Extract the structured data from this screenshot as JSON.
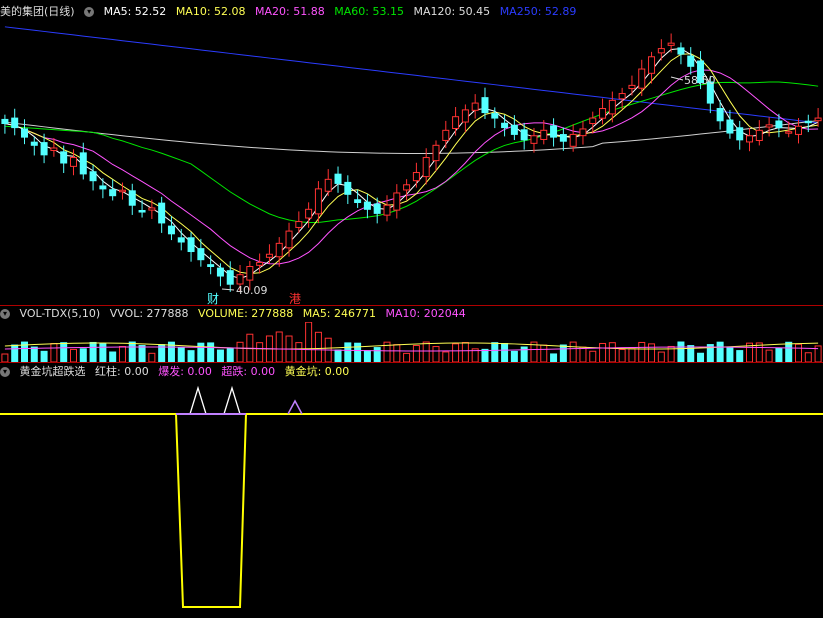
{
  "main_header": {
    "title": "美的集团(日线)",
    "ma5": "MA5: 52.52",
    "ma10": "MA10: 52.08",
    "ma20": "MA20: 51.88",
    "ma60": "MA60: 53.15",
    "ma120": "MA120: 50.45",
    "ma250": "MA250: 52.89"
  },
  "price_labels": {
    "high": "58.50",
    "low": "40.09",
    "tag1": "财",
    "tag2": "港"
  },
  "vol_header": {
    "title": "VOL-TDX(5,10)",
    "vvol": "VVOL: 277888",
    "volume": "VOLUME: 277888",
    "ma5": "MA5: 246771",
    "ma10": "MA10: 202044"
  },
  "ind_header": {
    "title": "黄金坑超跌选",
    "red": "红柱: 0.00",
    "burst": "爆发: 0.00",
    "over": "超跌: 0.00",
    "gold": "黄金坑: 0.00"
  },
  "colors": {
    "up": "#ff3232",
    "down": "#54ffff",
    "ma5": "#ffffff",
    "ma10": "#ffff54",
    "ma20": "#ff54ff",
    "ma60": "#00e600",
    "ma120": "#d0d0d0",
    "ma250": "#2b3cff",
    "indicator": "#ffff00",
    "burst": "#c080ff"
  },
  "chart_data": {
    "type": "candlestick",
    "y_range": [
      40.09,
      58.5
    ],
    "series_close": [
      52.4,
      52.1,
      51.4,
      50.8,
      50.1,
      50.6,
      49.5,
      49.9,
      48.7,
      48.2,
      47.6,
      47.1,
      47.5,
      46.4,
      45.9,
      46.2,
      45.1,
      44.3,
      43.7,
      43.0,
      42.4,
      41.9,
      41.2,
      40.6,
      41.3,
      41.9,
      42.2,
      42.8,
      43.6,
      44.5,
      45.2,
      46.1,
      47.6,
      48.3,
      48.0,
      47.2,
      46.6,
      46.1,
      45.8,
      46.4,
      47.3,
      47.9,
      48.8,
      49.9,
      50.8,
      51.9,
      52.9,
      53.4,
      53.9,
      53.2,
      52.8,
      52.1,
      51.6,
      51.2,
      51.5,
      51.9,
      51.4,
      51.1,
      51.6,
      52.0,
      52.8,
      53.5,
      54.1,
      54.6,
      55.2,
      56.4,
      57.3,
      57.9,
      58.3,
      57.5,
      56.6,
      55.4,
      53.9,
      52.6,
      51.7,
      51.2,
      51.5,
      51.9,
      52.3,
      52.1,
      51.8,
      52.2,
      52.5,
      52.8
    ]
  }
}
